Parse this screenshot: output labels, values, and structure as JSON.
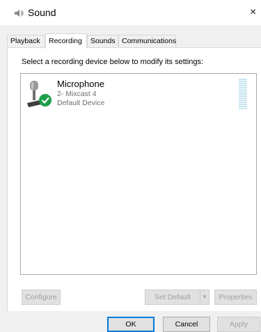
{
  "window": {
    "title": "Sound",
    "close_glyph": "×"
  },
  "tabs": [
    {
      "label": "Playback",
      "active": false
    },
    {
      "label": "Recording",
      "active": true
    },
    {
      "label": "Sounds",
      "active": false
    },
    {
      "label": "Communications",
      "active": false
    }
  ],
  "panel": {
    "instruction": "Select a recording device below to modify its settings:"
  },
  "device": {
    "name": "Microphone",
    "sub": "2- Mixcast 4",
    "status": "Default Device",
    "icon": "microphone-icon",
    "badge": "default-check-icon"
  },
  "panel_buttons": {
    "configure": "Configure",
    "set_default": "Set Default",
    "properties": "Properties"
  },
  "dialog_buttons": {
    "ok": "OK",
    "cancel": "Cancel",
    "apply": "Apply"
  },
  "colors": {
    "accent": "#0078d7",
    "check": "#1e9e4a",
    "meter": "#c6e4ef"
  }
}
